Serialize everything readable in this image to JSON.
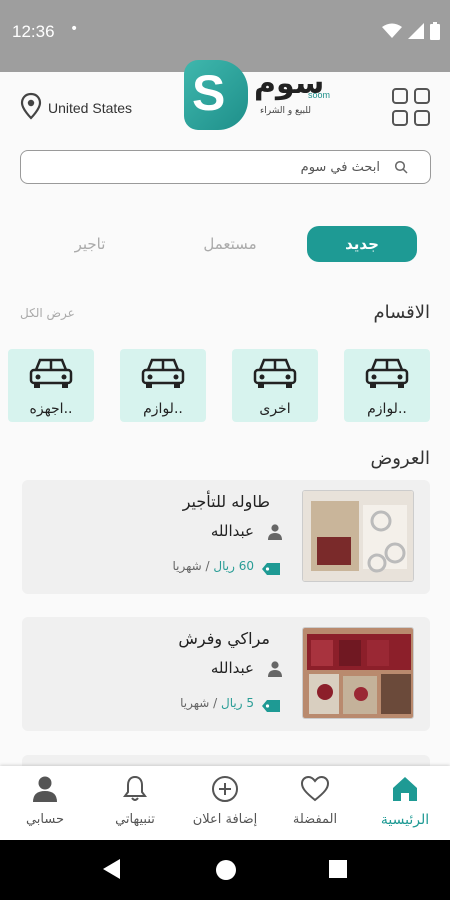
{
  "status_bar": {
    "time": "12:36",
    "dot": "•",
    "icons": [
      "wifi-icon",
      "signal-icon",
      "battery-icon"
    ]
  },
  "header": {
    "location": "United States",
    "location_icon": "location-pin-icon",
    "logo": {
      "mark_letter": "S",
      "wordmark": "سوم",
      "brand": "soom",
      "slogan": "للبيع و الشراء"
    },
    "menu_icon": "grid-icon"
  },
  "search": {
    "placeholder": "ابحث في سوم",
    "value": "",
    "icon": "search-icon"
  },
  "tabs": [
    {
      "label": "جديد",
      "active": true
    },
    {
      "label": "مستعمل",
      "active": false
    },
    {
      "label": "تاجير",
      "active": false
    }
  ],
  "categories_section": {
    "title": "الاقسام",
    "see_all": "عرض الكل",
    "items": [
      {
        "label": "لوازم..",
        "icon": "car-icon"
      },
      {
        "label": "اخرى",
        "icon": "car-icon"
      },
      {
        "label": "لوازم..",
        "icon": "car-icon"
      },
      {
        "label": "اجهزه..",
        "icon": "car-icon"
      }
    ]
  },
  "offers_section": {
    "title": "العروض",
    "items": [
      {
        "title": "طاوله للتأجير",
        "owner": "عبدالله",
        "price": "60 ريال",
        "separator": "/",
        "period": "شهريا"
      },
      {
        "title": "مراكي وفرش",
        "owner": "عبدالله",
        "price": "5 ريال",
        "separator": "/",
        "period": "شهريا"
      }
    ]
  },
  "bottom_nav": [
    {
      "label": "الرئيسية",
      "icon": "home-icon",
      "active": true
    },
    {
      "label": "المفضلة",
      "icon": "heart-icon",
      "active": false
    },
    {
      "label": "إضافة اعلان",
      "icon": "add-circle-icon",
      "active": false
    },
    {
      "label": "تنبيهاتي",
      "icon": "bell-icon",
      "active": false
    },
    {
      "label": "حسابي",
      "icon": "person-icon",
      "active": false
    }
  ],
  "colors": {
    "accent": "#1e9a94",
    "category_bg": "#d7f3ee",
    "status_bar": "#9e9e9e"
  }
}
